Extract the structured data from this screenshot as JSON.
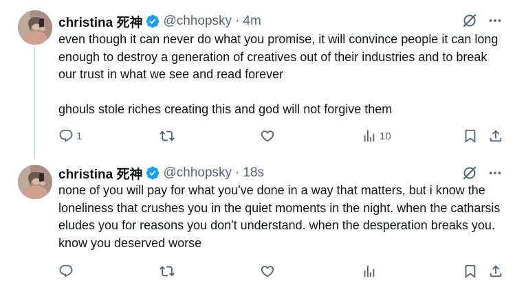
{
  "tweets": [
    {
      "author": {
        "name": "christina 死神",
        "handle": "@chhopsky",
        "verified": true
      },
      "separator": "·",
      "time": "4m",
      "paragraphs": [
        "even though it can never do what you promise, it will convince people it can long enough to destroy a generation of creatives out of their industries and to break our trust in what we see and read forever",
        "ghouls stole riches creating this and god will not forgive them"
      ],
      "stats": {
        "replies": "1",
        "reposts": "",
        "likes": "",
        "views": "10"
      }
    },
    {
      "author": {
        "name": "christina 死神",
        "handle": "@chhopsky",
        "verified": true
      },
      "separator": "·",
      "time": "18s",
      "paragraphs": [
        "none of you will pay for what you've done in a way that matters, but i know the loneliness that crushes you in the quiet moments in the night. when the catharsis eludes you for reasons you don't understand. when the desperation breaks you. know you deserved worse"
      ],
      "stats": {
        "replies": "",
        "reposts": "",
        "likes": "",
        "views": ""
      }
    }
  ],
  "icons": {
    "verified": "verified-badge-icon",
    "grok": "grok-icon",
    "more": "more-icon",
    "reply": "reply-icon",
    "repost": "repost-icon",
    "like": "heart-icon",
    "views": "views-chart-icon",
    "bookmark": "bookmark-icon",
    "share": "share-icon"
  },
  "colors": {
    "text": "#0f1419",
    "secondary": "#536471",
    "verified": "#1d9bf0",
    "thread_line": "#cfd9de"
  }
}
